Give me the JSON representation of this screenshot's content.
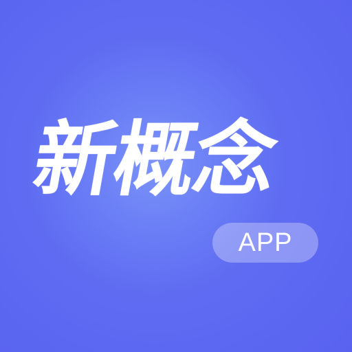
{
  "brand": {
    "title": "新概念",
    "badge": "APP"
  },
  "colors": {
    "background": "#5d68f1",
    "highlight": "#7b93f8",
    "text": "#ffffff",
    "badge_fill": "rgba(255,255,255,0.30)"
  }
}
